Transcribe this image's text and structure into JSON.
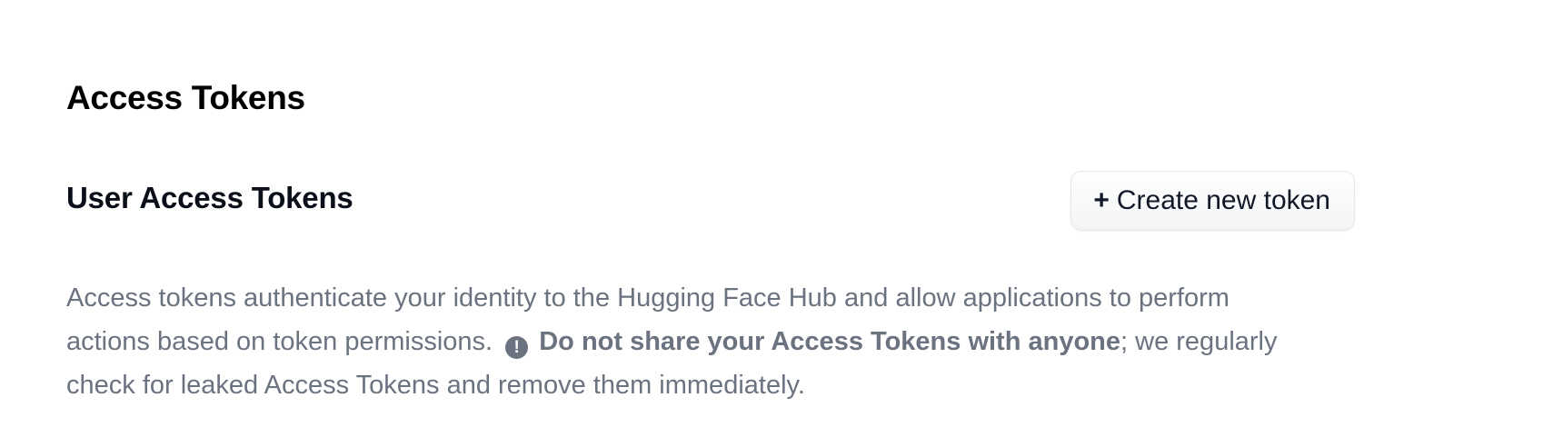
{
  "page": {
    "title": "Access Tokens"
  },
  "section": {
    "title": "User Access Tokens",
    "create_button": {
      "icon": "plus-icon",
      "plus": "+",
      "label": "Create new token"
    }
  },
  "description": {
    "part1": "Access tokens authenticate your identity to the Hugging Face Hub and allow applications to perform actions based on token permissions.",
    "warning_icon": "exclamation-circle-icon",
    "warning_glyph": "!",
    "warning_bold_1": "Do not share your ",
    "warning_bold_2": "Access Tokens",
    "warning_bold_3": " with anyone",
    "part2": "; we regularly check for leaked Access Tokens and remove them immediately."
  },
  "colors": {
    "text_muted": "#6b7280",
    "text_heading": "#000000",
    "button_border": "#e5e7eb"
  }
}
